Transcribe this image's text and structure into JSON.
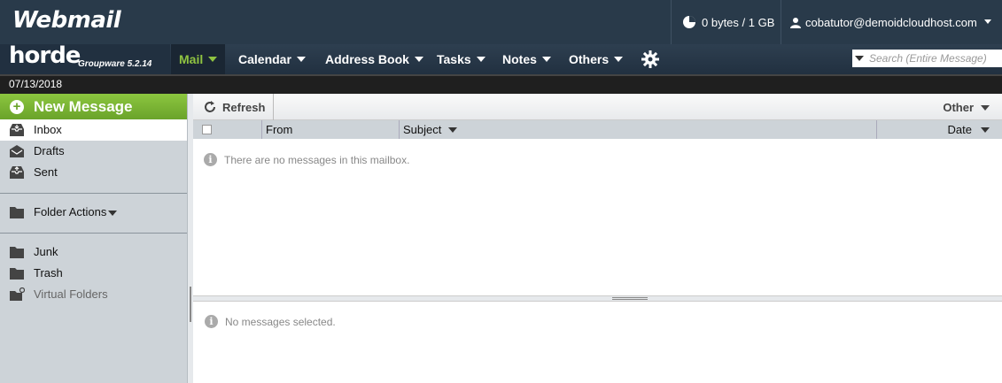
{
  "topbar": {
    "brand": "Webmail",
    "quota": "0 bytes / 1 GB",
    "user": "cobatutor@demoidcloudhost.com"
  },
  "horde": {
    "logo": "horde",
    "subtitle": "Groupware 5.2.14"
  },
  "nav": {
    "items": [
      {
        "label": "Mail",
        "active": true
      },
      {
        "label": "Calendar"
      },
      {
        "label": "Address Book"
      },
      {
        "label": "Tasks"
      },
      {
        "label": "Notes"
      },
      {
        "label": "Others"
      }
    ],
    "settings_icon": "gear-icon",
    "search_placeholder": "Search (Entire Message)"
  },
  "date": "07/13/2018",
  "sidebar": {
    "new_message": "New Message",
    "folders": [
      {
        "label": "Inbox",
        "icon": "inbox-icon",
        "selected": true
      },
      {
        "label": "Drafts",
        "icon": "drafts-icon"
      },
      {
        "label": "Sent",
        "icon": "sent-icon"
      }
    ],
    "folder_actions": "Folder Actions",
    "other_folders": [
      {
        "label": "Junk",
        "icon": "folder-icon"
      },
      {
        "label": "Trash",
        "icon": "folder-icon"
      },
      {
        "label": "Virtual Folders",
        "icon": "virtual-folder-icon",
        "disabled": true
      }
    ]
  },
  "toolbar": {
    "refresh": "Refresh",
    "other": "Other"
  },
  "columns": {
    "from": "From",
    "subject": "Subject",
    "date": "Date"
  },
  "messages": {
    "empty_text": "There are no messages in this mailbox.",
    "preview_text": "No messages selected."
  },
  "colors": {
    "topbar": "#293a4a",
    "accent_green": "#8cc63f",
    "sidebar_bg": "#cdd3d8"
  }
}
